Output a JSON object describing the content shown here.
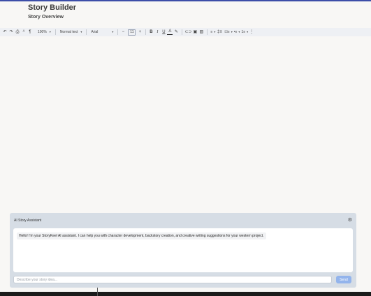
{
  "document": {
    "title": "Story Builder",
    "subtitle": "Story Overview"
  },
  "toolbar": {
    "undo_icon": "↶",
    "redo_icon": "↷",
    "print_icon": "⎙",
    "spellcheck_icon": "ᴬ",
    "paint_format_icon": "¶",
    "zoom": "100%",
    "style": "Normal text",
    "font": "Arial",
    "font_size": "11",
    "decrease_label": "−",
    "increase_label": "+",
    "bold_label": "B",
    "italic_label": "I",
    "underline_label": "U",
    "text_color_label": "A",
    "highlight_icon": "✎",
    "link_icon": "⊂⊃",
    "comment_icon": "▣",
    "image_icon": "▨",
    "align_icon": "≡",
    "line_spacing_icon": "‡≡",
    "checklist_icon": "☑≡",
    "bullets_icon": "•≡",
    "numbered_icon": "1≡",
    "more_icon": "⋮",
    "caret": "▾"
  },
  "assistant": {
    "title": "AI Story Assistant",
    "settings_icon": "⚙",
    "message": "Hello! I'm your StoryKeel AI assistant. I can help you with character development, backstory creation, and creative writing suggestions for your western project.",
    "input_value": "",
    "input_placeholder": "Describe your story idea...",
    "send_label": "Send"
  }
}
